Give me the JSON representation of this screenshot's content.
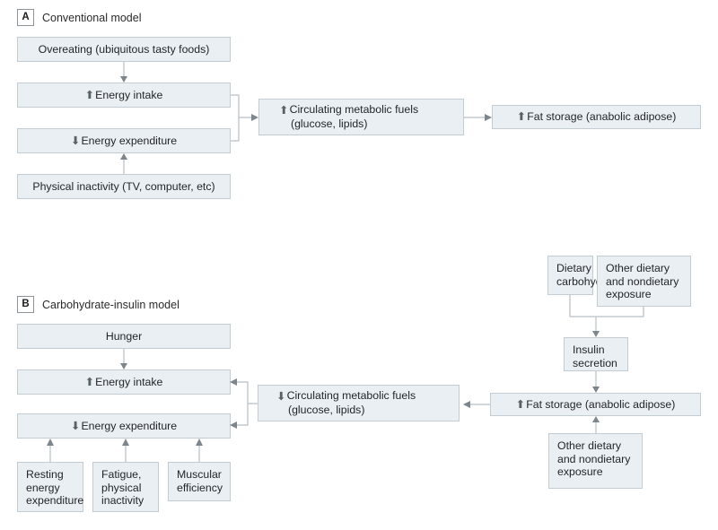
{
  "figure": {
    "type": "flow-diagram",
    "panels": [
      {
        "letter": "A",
        "title": "Conventional model",
        "nodes": [
          {
            "id": "a-overeating",
            "label": "Overeating (ubiquitous tasty foods)",
            "arrow": "none"
          },
          {
            "id": "a-intake",
            "label": "Energy intake",
            "arrow": "up"
          },
          {
            "id": "a-expenditure",
            "label": "Energy expenditure",
            "arrow": "down"
          },
          {
            "id": "a-inactivity",
            "label": "Physical inactivity (TV, computer, etc)",
            "arrow": "none"
          },
          {
            "id": "a-fuels-l1",
            "label": "Circulating metabolic fuels",
            "arrow": "up"
          },
          {
            "id": "a-fuels-l2",
            "label": "(glucose, lipids)",
            "arrow": "none"
          },
          {
            "id": "a-fat",
            "label": "Fat storage (anabolic adipose)",
            "arrow": "up"
          }
        ]
      },
      {
        "letter": "B",
        "title": "Carbohydrate-insulin model",
        "nodes": [
          {
            "id": "b-hunger",
            "label": "Hunger",
            "arrow": "none"
          },
          {
            "id": "b-intake",
            "label": "Energy intake",
            "arrow": "up"
          },
          {
            "id": "b-expenditure",
            "label": "Energy expenditure",
            "arrow": "down"
          },
          {
            "id": "b-resting",
            "label": "Resting\nenergy\nexpenditure",
            "arrow": "none"
          },
          {
            "id": "b-fatigue",
            "label": "Fatigue,\nphysical\ninactivity",
            "arrow": "none"
          },
          {
            "id": "b-muscular",
            "label": "Muscular\nefficiency",
            "arrow": "none"
          },
          {
            "id": "b-fuels-l1",
            "label": "Circulating metabolic fuels",
            "arrow": "down"
          },
          {
            "id": "b-fuels-l2",
            "label": "(glucose, lipids)",
            "arrow": "none"
          },
          {
            "id": "b-carb",
            "label": "Dietary\ncarbohydrate",
            "arrow": "none"
          },
          {
            "id": "b-other-top",
            "label": "Other dietary\nand nondietary\nexposure",
            "arrow": "none"
          },
          {
            "id": "b-insulin",
            "label": "Insulin\nsecretion",
            "arrow": "none"
          },
          {
            "id": "b-fat",
            "label": "Fat storage (anabolic adipose)",
            "arrow": "up"
          },
          {
            "id": "b-other-bot",
            "label": "Other dietary\nand nondietary\nexposure",
            "arrow": "none"
          }
        ]
      }
    ],
    "glyphs": {
      "up": "⬆",
      "down": "⬇"
    },
    "colors": {
      "box_fill": "#e9eff3",
      "box_border": "#c3ccd2",
      "connector": "#b7bfc5",
      "arrow_head": "#7d868c",
      "text": "#232629"
    }
  }
}
